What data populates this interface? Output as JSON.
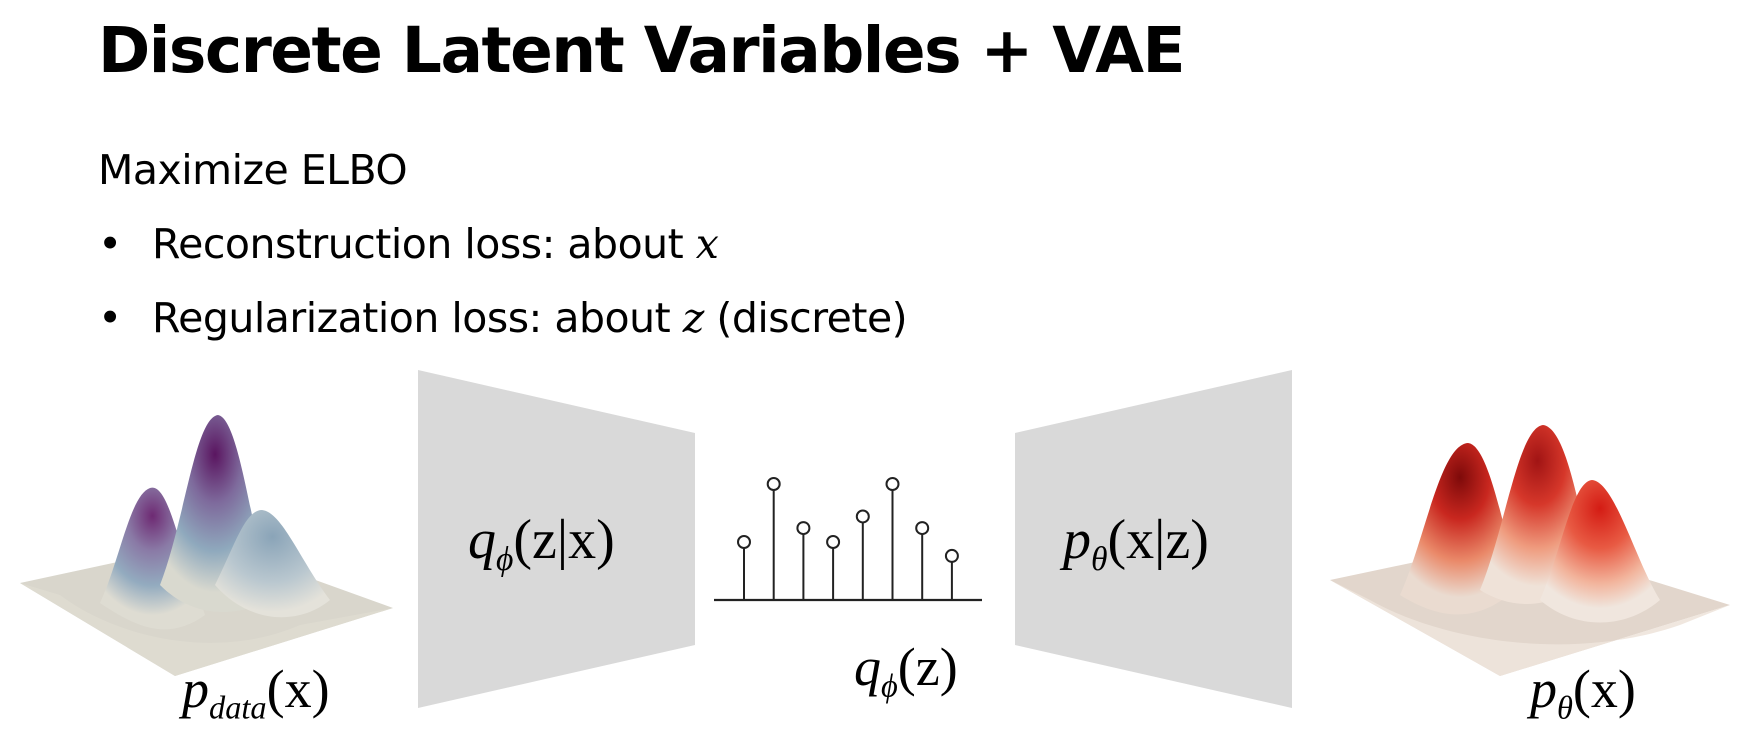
{
  "slide": {
    "title": "Discrete Latent Variables + VAE",
    "subtitle": "Maximize ELBO",
    "bullets": [
      {
        "bullet_char": "•",
        "text": "Reconstruction loss: about ",
        "var": "x",
        "suffix": ""
      },
      {
        "bullet_char": "•",
        "text": "Regularization loss: about ",
        "var": "z",
        "suffix": " (discrete)"
      }
    ]
  },
  "diagram": {
    "encoder_label": {
      "fn": "q",
      "sub": "ϕ",
      "args": "(z|x)"
    },
    "decoder_label": {
      "fn": "p",
      "sub": "θ",
      "args": "(x|z)"
    },
    "prior_label": {
      "fn": "q",
      "sub": "ϕ",
      "args": "(z)"
    },
    "data_label": {
      "fn": "p",
      "sub": "data",
      "args": "(x)"
    },
    "model_label": {
      "fn": "p",
      "sub": "θ",
      "args": "(x)"
    },
    "stem_values": [
      0.5,
      1.0,
      0.62,
      0.5,
      0.72,
      1.0,
      0.62,
      0.38
    ],
    "colors": {
      "network_block": "#d9d9d9",
      "data_surface_peak": "#6b1f6e",
      "data_surface_mid": "#8aa5b9",
      "model_surface_peak": "#9c1010",
      "model_surface_mid": "#e8553a",
      "surface_base": "#d8d3c8"
    }
  }
}
